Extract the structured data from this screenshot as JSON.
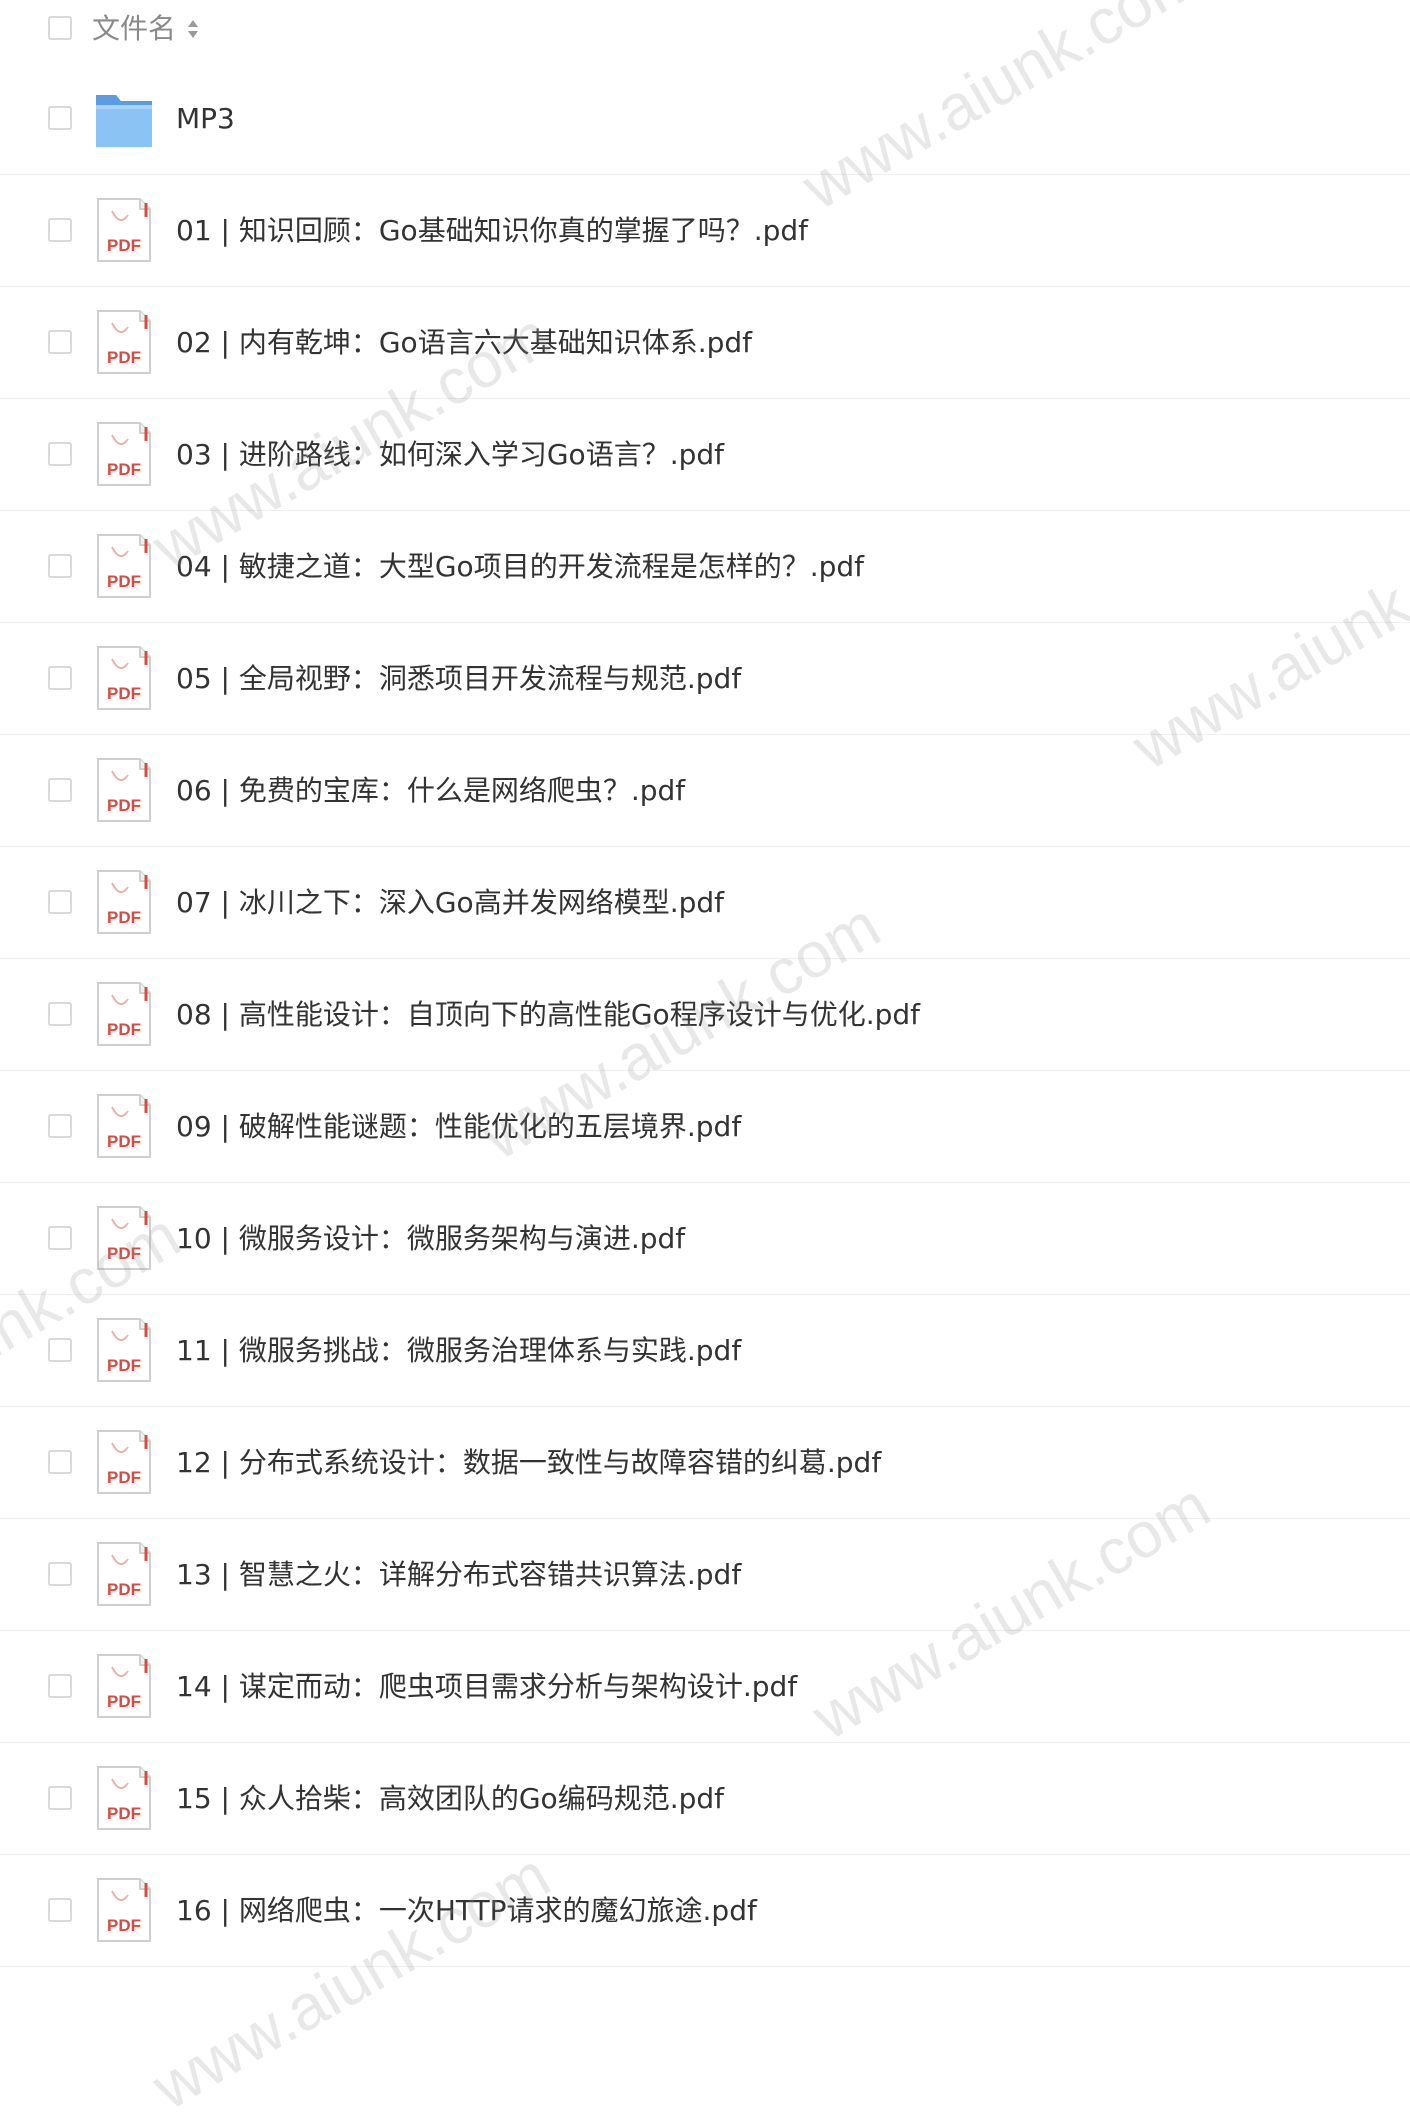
{
  "header": {
    "name_label": "文件名"
  },
  "watermark_text": "www.aiunk.com",
  "colors": {
    "folder": "#6aa9e8",
    "pdf_red": "#d94b3f",
    "divider": "#eeeeee"
  },
  "files": [
    {
      "name": "MP3",
      "type": "folder"
    },
    {
      "name": "01 | 知识回顾：Go基础知识你真的掌握了吗？.pdf",
      "type": "pdf"
    },
    {
      "name": "02 | 内有乾坤：Go语言六大基础知识体系.pdf",
      "type": "pdf"
    },
    {
      "name": "03 | 进阶路线：如何深入学习Go语言？.pdf",
      "type": "pdf"
    },
    {
      "name": "04 | 敏捷之道：大型Go项目的开发流程是怎样的？.pdf",
      "type": "pdf"
    },
    {
      "name": "05 | 全局视野：洞悉项目开发流程与规范.pdf",
      "type": "pdf"
    },
    {
      "name": "06 | 免费的宝库：什么是网络爬虫？.pdf",
      "type": "pdf"
    },
    {
      "name": "07 | 冰川之下：深入Go高并发网络模型.pdf",
      "type": "pdf"
    },
    {
      "name": "08 | 高性能设计：自顶向下的高性能Go程序设计与优化.pdf",
      "type": "pdf"
    },
    {
      "name": "09 | 破解性能谜题：性能优化的五层境界.pdf",
      "type": "pdf"
    },
    {
      "name": "10 | 微服务设计：微服务架构与演进.pdf",
      "type": "pdf"
    },
    {
      "name": "11 | 微服务挑战：微服务治理体系与实践.pdf",
      "type": "pdf"
    },
    {
      "name": "12 | 分布式系统设计：数据一致性与故障容错的纠葛.pdf",
      "type": "pdf"
    },
    {
      "name": "13 | 智慧之火：详解分布式容错共识算法.pdf",
      "type": "pdf"
    },
    {
      "name": "14 | 谋定而动：爬虫项目需求分析与架构设计.pdf",
      "type": "pdf"
    },
    {
      "name": "15 | 众人拾柴：高效团队的Go编码规范.pdf",
      "type": "pdf"
    },
    {
      "name": "16 | 网络爬虫：一次HTTP请求的魔幻旅途.pdf",
      "type": "pdf"
    }
  ]
}
